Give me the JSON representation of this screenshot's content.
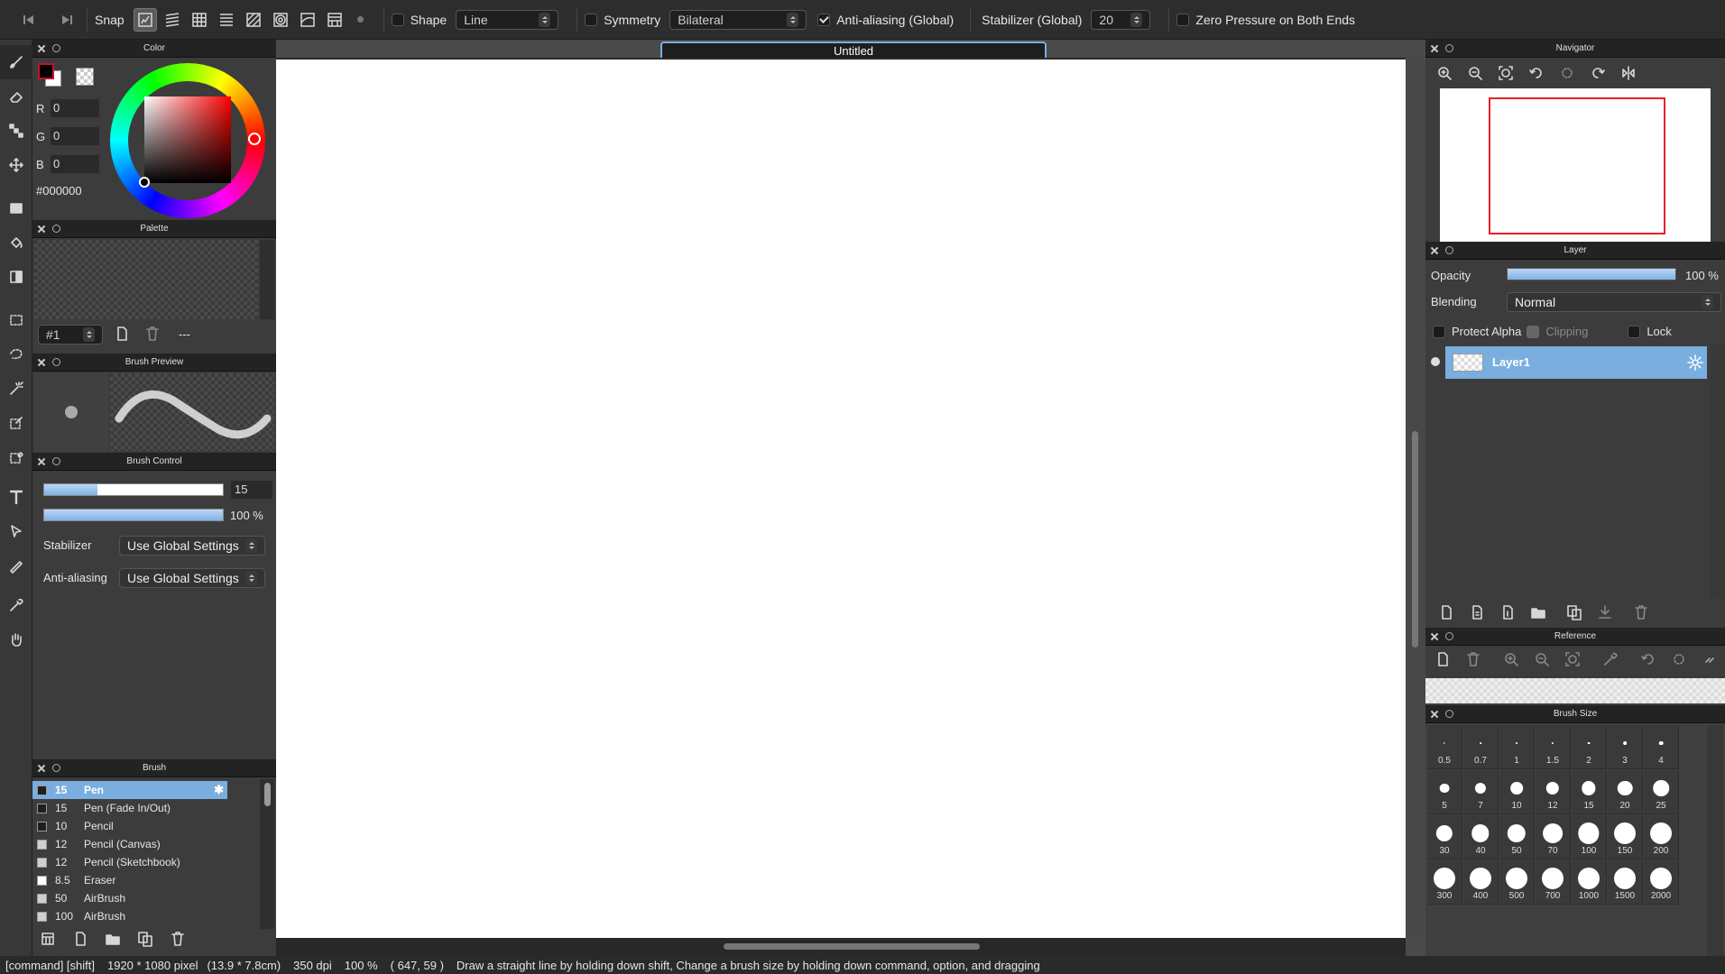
{
  "topbar": {
    "snap_label": "Snap",
    "shape_label": "Shape",
    "shape_value": "Line",
    "symmetry_label": "Symmetry",
    "symmetry_value": "Bilateral",
    "antialias_label": "Anti-aliasing (Global)",
    "stabilizer_label": "Stabilizer (Global)",
    "stabilizer_value": "20",
    "zero_pressure_label": "Zero Pressure on Both Ends"
  },
  "color_panel": {
    "title": "Color",
    "r_label": "R",
    "r_value": "0",
    "g_label": "G",
    "g_value": "0",
    "b_label": "B",
    "b_value": "0",
    "hex": "#000000"
  },
  "palette_panel": {
    "title": "Palette",
    "palette_id": "#1",
    "palette_name": "---"
  },
  "brush_preview_panel": {
    "title": "Brush Preview"
  },
  "brush_control_panel": {
    "title": "Brush Control",
    "size_value": "15",
    "size_fraction": 0.3,
    "opacity_value": "100 %",
    "opacity_fraction": 1.0,
    "stabilizer_label": "Stabilizer",
    "stabilizer_value": "Use Global Settings",
    "antialias_label": "Anti-aliasing",
    "antialias_value": "Use Global Settings"
  },
  "brush_panel": {
    "title": "Brush",
    "items": [
      {
        "size": "15",
        "name": "Pen",
        "swatch": "#1f1f1f"
      },
      {
        "size": "15",
        "name": "Pen (Fade In/Out)",
        "swatch": "#1f1f1f"
      },
      {
        "size": "10",
        "name": "Pencil",
        "swatch": "#1f1f1f"
      },
      {
        "size": "12",
        "name": "Pencil (Canvas)",
        "swatch": "#cfcfcf"
      },
      {
        "size": "12",
        "name": "Pencil (Sketchbook)",
        "swatch": "#cfcfcf"
      },
      {
        "size": "8.5",
        "name": "Eraser",
        "swatch": "#ffffff"
      },
      {
        "size": "50",
        "name": "AirBrush",
        "swatch": "#cfcfcf"
      },
      {
        "size": "100",
        "name": "AirBrush",
        "swatch": "#cfcfcf"
      }
    ]
  },
  "canvas": {
    "tab_title": "Untitled"
  },
  "navigator_panel": {
    "title": "Navigator"
  },
  "layer_panel": {
    "title": "Layer",
    "opacity_label": "Opacity",
    "opacity_value": "100 %",
    "opacity_fraction": 1.0,
    "blending_label": "Blending",
    "blending_value": "Normal",
    "protect_alpha_label": "Protect Alpha",
    "clipping_label": "Clipping",
    "lock_label": "Lock",
    "layers": [
      {
        "name": "Layer1"
      }
    ]
  },
  "reference_panel": {
    "title": "Reference"
  },
  "brush_size_panel": {
    "title": "Brush Size",
    "sizes": [
      "0.5",
      "0.7",
      "1",
      "1.5",
      "2",
      "3",
      "4",
      "5",
      "7",
      "10",
      "12",
      "15",
      "20",
      "25",
      "30",
      "40",
      "50",
      "70",
      "100",
      "150",
      "200",
      "300",
      "400",
      "500",
      "700",
      "1000",
      "1500",
      "2000"
    ]
  },
  "status": {
    "modifiers": "[command] [shift]",
    "dimensions": "1920 * 1080 pixel",
    "physical": "(13.9 * 7.8cm)",
    "dpi": "350 dpi",
    "zoom": "100 %",
    "coords": "( 647, 59 )",
    "hint": "Draw a straight line by holding down shift, Change a brush size by holding down command, option, and dragging"
  },
  "colors": {
    "accent": "#7aaedf",
    "foreground": "#000000",
    "navigator_frame": "#e8202a"
  }
}
